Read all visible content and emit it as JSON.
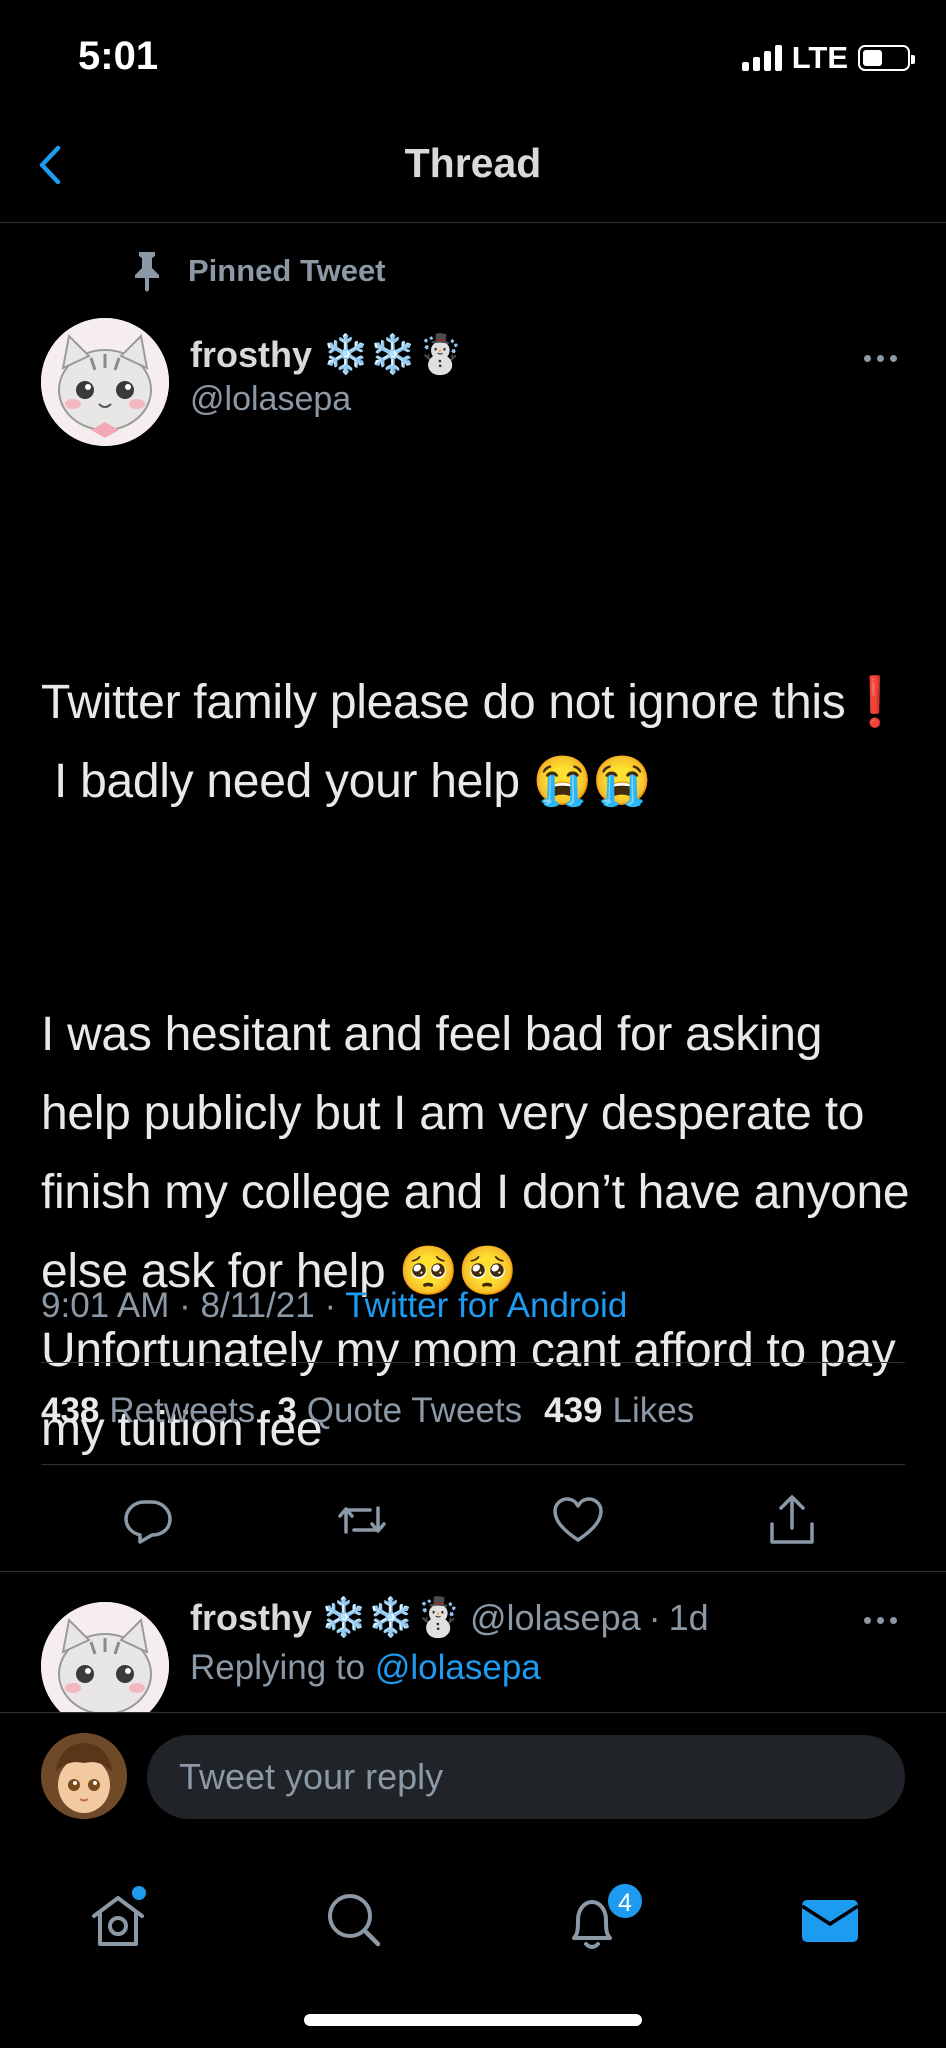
{
  "status_bar": {
    "time": "5:01",
    "network": "LTE",
    "battery_level": 0.45
  },
  "header": {
    "title": "Thread"
  },
  "pinned": {
    "label": "Pinned Tweet"
  },
  "tweet": {
    "author_name": "frosthy",
    "author_emojis": "❄️❄️☃️",
    "handle": "@lolasepa",
    "paragraph_1": "Twitter family please do not ignore this❗️\n I badly need your help 😭😭",
    "paragraph_2": "I was hesitant and feel bad for asking help publicly but I am very desperate to finish my college and I don’t have anyone else ask for help 🥺🥺\nUnfortunately my mom cant afford to pay my tuition fee",
    "time": "9:01 AM",
    "date": "8/11/21",
    "source": "Twitter for Android",
    "retweets_count": "438",
    "retweets_label": "Retweets",
    "quotes_count": "3",
    "quotes_label": "Quote Tweets",
    "likes_count": "439",
    "likes_label": "Likes"
  },
  "reply": {
    "author_name": "frosthy",
    "author_emojis": "❄️❄️☃️",
    "handle": "@lolasepa",
    "age": "1d",
    "replying_prefix": "Replying to",
    "replying_to": "@lolasepa"
  },
  "compose": {
    "placeholder": "Tweet your reply"
  },
  "tabbar": {
    "notifications_badge": "4"
  },
  "colors": {
    "accent": "#1d9bf0",
    "background": "#000000",
    "secondary_text": "#8b98a5"
  }
}
